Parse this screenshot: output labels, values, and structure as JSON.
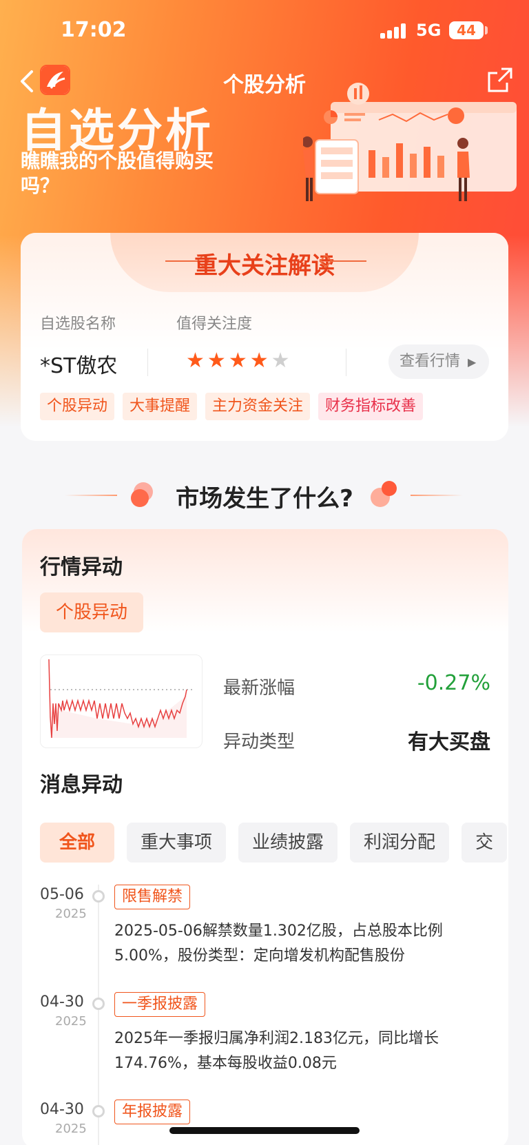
{
  "status_bar": {
    "time": "17:02",
    "network": "5G",
    "battery": "44"
  },
  "nav": {
    "title": "个股分析"
  },
  "hero": {
    "title": "自选分析",
    "subtitle": "瞧瞧我的个股值得购买吗？"
  },
  "focus_card": {
    "banner_title": "重大关注解读",
    "col1_label": "自选股名称",
    "col2_label": "值得关注度",
    "stock_name": "*ST傲农",
    "rating": 4,
    "rating_max": 5,
    "quote_button": "查看行情",
    "tags": [
      {
        "label": "个股异动",
        "color": "#f0551c",
        "bg": "#ffeee5"
      },
      {
        "label": "大事提醒",
        "color": "#f0551c",
        "bg": "#ffeee5"
      },
      {
        "label": "主力资金关注",
        "color": "#f0551c",
        "bg": "#ffeee5"
      },
      {
        "label": "财务指标改善",
        "color": "#e8304a",
        "bg": "#ffe8ec"
      }
    ]
  },
  "section": {
    "title": "市场发生了什么?"
  },
  "market_card": {
    "title": "行情异动",
    "pill": "个股异动",
    "change_label": "最新涨幅",
    "change_value": "-0.27%",
    "change_color": "#22a03a",
    "type_label": "异动类型",
    "type_value": "有大买盘",
    "news_title": "消息异动",
    "filters": [
      "全部",
      "重大事项",
      "业绩披露",
      "利润分配",
      "交"
    ],
    "events": [
      {
        "date": "05-06",
        "year": "2025",
        "tag": "限售解禁",
        "text": "2025-05-06解禁数量1.302亿股，占总股本比例5.00%，股份类型：定向增发机构配售股份"
      },
      {
        "date": "04-30",
        "year": "2025",
        "tag": "一季报披露",
        "text": "2025年一季报归属净利润2.183亿元，同比增长174.76%，基本每股收益0.08元"
      },
      {
        "date": "04-30",
        "year": "2025",
        "tag": "年报披露",
        "text": ""
      }
    ]
  },
  "colors": {
    "accent": "#f0551c",
    "star_on": "#ff5a1a",
    "star_off": "#cfcfcf"
  }
}
